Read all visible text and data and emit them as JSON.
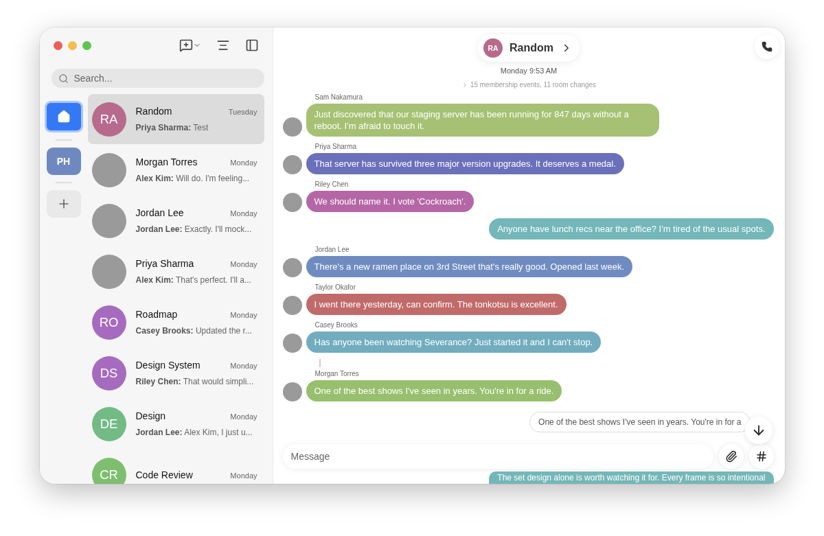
{
  "sidebar": {
    "search": {
      "placeholder": "Search..."
    },
    "spaces": [
      {
        "kind": "home",
        "selected": true
      },
      {
        "kind": "initials",
        "label": "PH",
        "selected": false
      },
      {
        "kind": "add",
        "selected": false
      }
    ],
    "rooms": [
      {
        "name": "Random",
        "time": "Tuesday",
        "sender": "Priya Sharma:",
        "preview": "Test",
        "avatar": {
          "kind": "initials",
          "label": "RA",
          "color": "#b86a8c"
        },
        "selected": true
      },
      {
        "name": "Morgan Torres",
        "time": "Monday",
        "sender": "Alex Kim:",
        "preview": "Will do. I'm feeling...",
        "avatar": {
          "kind": "photo"
        },
        "selected": false
      },
      {
        "name": "Jordan Lee",
        "time": "Monday",
        "sender": "Jordan Lee:",
        "preview": "Exactly. I'll mock...",
        "avatar": {
          "kind": "photo"
        },
        "selected": false
      },
      {
        "name": "Priya Sharma",
        "time": "Monday",
        "sender": "Alex Kim:",
        "preview": "That's perfect. I'll a...",
        "avatar": {
          "kind": "photo"
        },
        "selected": false
      },
      {
        "name": "Roadmap",
        "time": "Monday",
        "sender": "Casey Brooks:",
        "preview": "Updated the r...",
        "avatar": {
          "kind": "initials",
          "label": "RO",
          "color": "#a66bbf"
        },
        "selected": false
      },
      {
        "name": "Design System",
        "time": "Monday",
        "sender": "Riley Chen:",
        "preview": "That would simpli...",
        "avatar": {
          "kind": "initials",
          "label": "DS",
          "color": "#a66bbf"
        },
        "selected": false
      },
      {
        "name": "Design",
        "time": "Monday",
        "sender": "Jordan Lee:",
        "preview": "Alex Kim, I just u...",
        "avatar": {
          "kind": "initials",
          "label": "DE",
          "color": "#72bb84"
        },
        "selected": false
      },
      {
        "name": "Code Review",
        "time": "Monday",
        "avatar": {
          "kind": "initials",
          "label": "CR",
          "color": "#7dbf6e"
        },
        "selected": false
      }
    ]
  },
  "chat": {
    "header": {
      "avatar": {
        "label": "RA",
        "color": "#b86a8c"
      },
      "name": "Random"
    },
    "date": "Monday 9:53 AM",
    "events": "15 membership events, 11 room changes",
    "messages": [
      {
        "kind": "incoming",
        "sender": "Sam Nakamura",
        "text": "Just discovered that our staging server has been running for 847 days without a reboot. I'm afraid to touch it.",
        "color": "#a6c173"
      },
      {
        "kind": "incoming",
        "sender": "Priya Sharma",
        "text": "That server has survived three major version upgrades. It deserves a medal.",
        "color": "#6b70bb"
      },
      {
        "kind": "incoming",
        "sender": "Riley Chen",
        "text": "We should name it. I vote 'Cockroach'.",
        "color": "#b566a6"
      },
      {
        "kind": "outgoing",
        "text": "Anyone have lunch recs near the office? I'm tired of the usual spots.",
        "color": "#74b7b8"
      },
      {
        "kind": "incoming",
        "sender": "Jordan Lee",
        "text": "There's a new ramen place on 3rd Street that's really good. Opened last week.",
        "color": "#6f8cc1"
      },
      {
        "kind": "incoming",
        "sender": "Taylor Okafor",
        "text": "I went there yesterday, can confirm. The tonkotsu is excellent.",
        "color": "#c16a6a"
      },
      {
        "kind": "incoming",
        "sender": "Casey Brooks",
        "text": "Has anyone been watching Severance? Just started it and I can't stop.",
        "color": "#72adbf"
      },
      {
        "kind": "incoming",
        "sender": "Morgan Torres",
        "text": "One of the best shows I've seen in years. You're in for a ride.",
        "color": "#98bf6e",
        "thread": true
      }
    ],
    "reply_preview": "One of the best shows I've seen in years. You're in for a",
    "composer": {
      "placeholder": "Message"
    },
    "trailing": {
      "text": "The set design alone is worth watching it for. Every frame is so intentional",
      "color": "#74b7b8"
    }
  }
}
